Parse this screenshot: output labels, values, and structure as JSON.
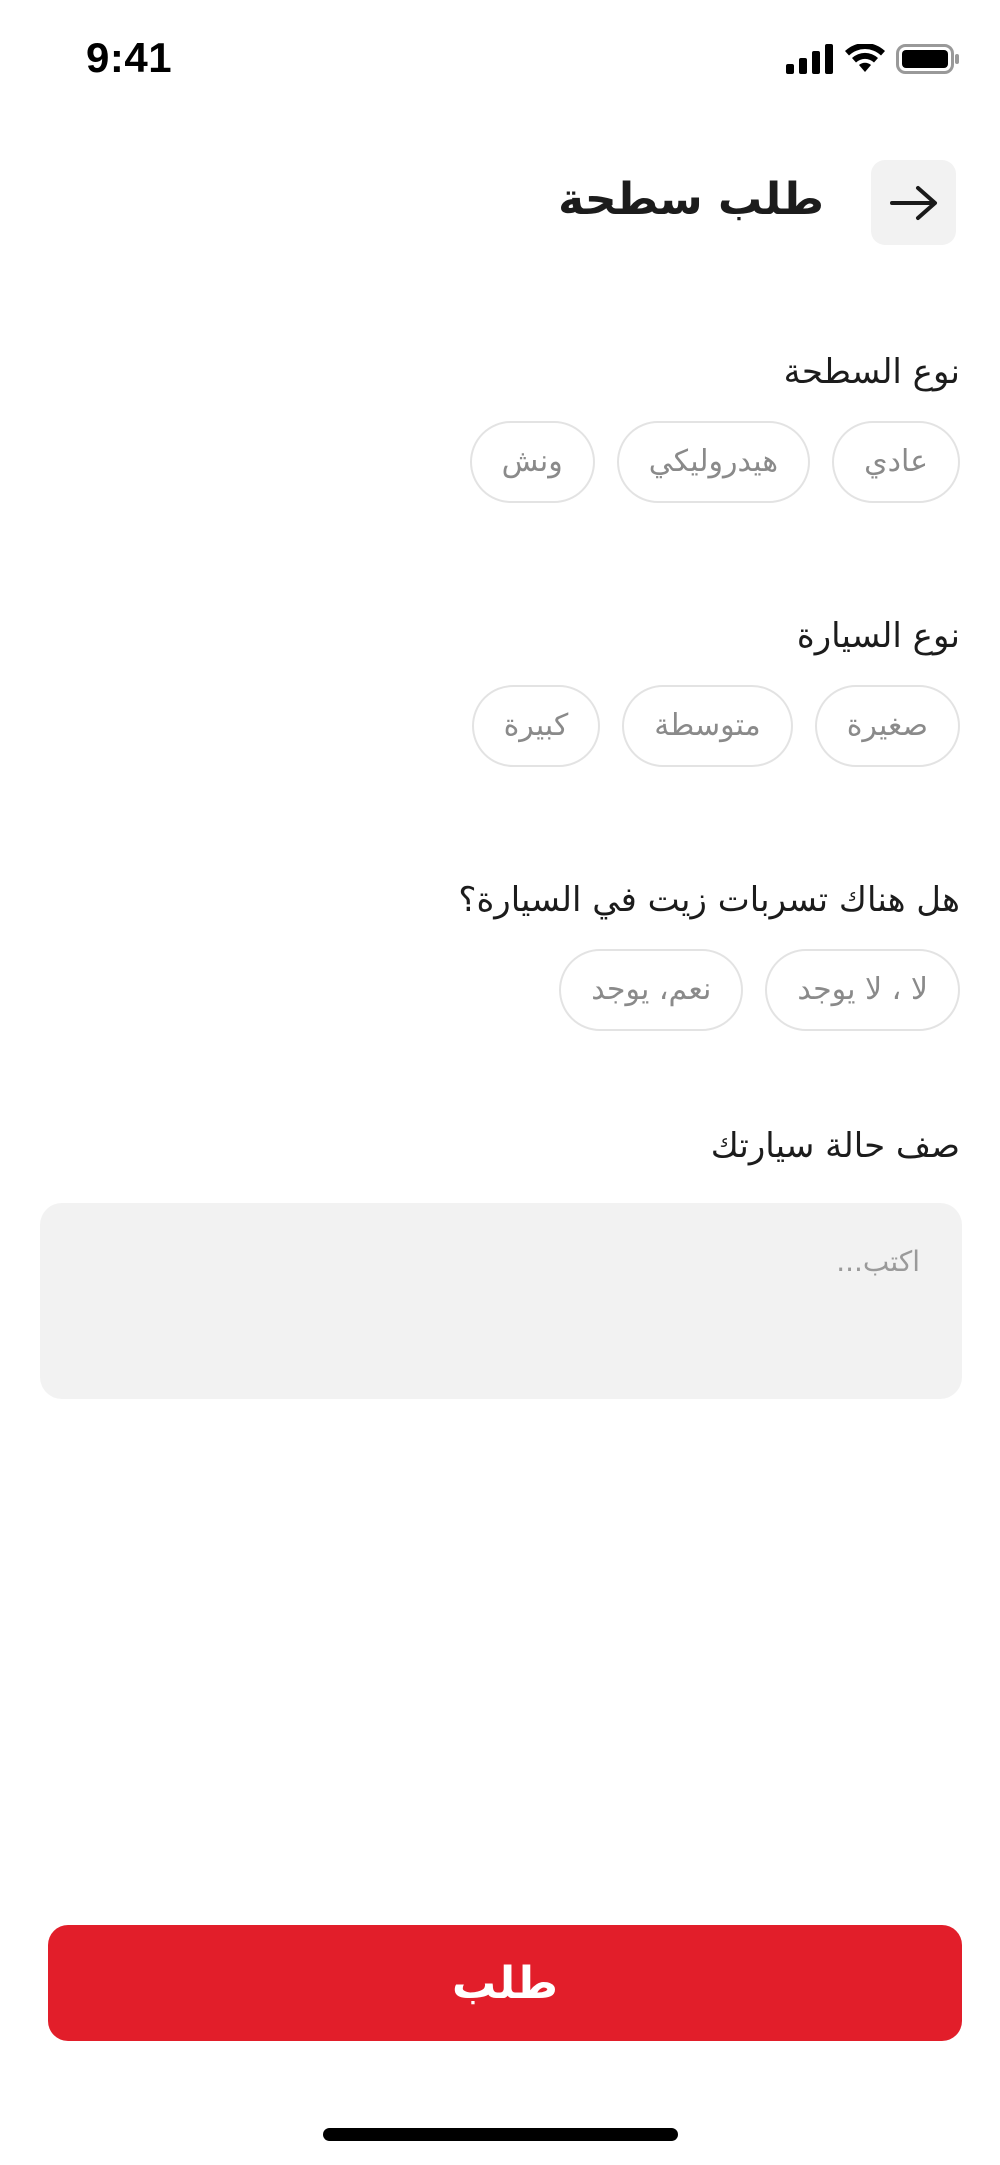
{
  "status_bar": {
    "time": "9:41"
  },
  "header": {
    "title": "طلب سطحة",
    "back_icon": "arrow-right-icon"
  },
  "tow_type": {
    "label": "نوع السطحة",
    "options": [
      "عادي",
      "هيدروليكي",
      "ونش"
    ]
  },
  "car_type": {
    "label": "نوع السيارة",
    "options": [
      "صغيرة",
      "متوسطة",
      "كبيرة"
    ]
  },
  "oil_leak": {
    "label": "هل هناك تسربات زيت في السيارة؟",
    "options": [
      "لا ، لا يوجد",
      "نعم، يوجد"
    ]
  },
  "description": {
    "label": "صف حالة سيارتك",
    "placeholder": "اكتب..."
  },
  "submit": {
    "label": "طلب",
    "color": "#e21e2a"
  }
}
